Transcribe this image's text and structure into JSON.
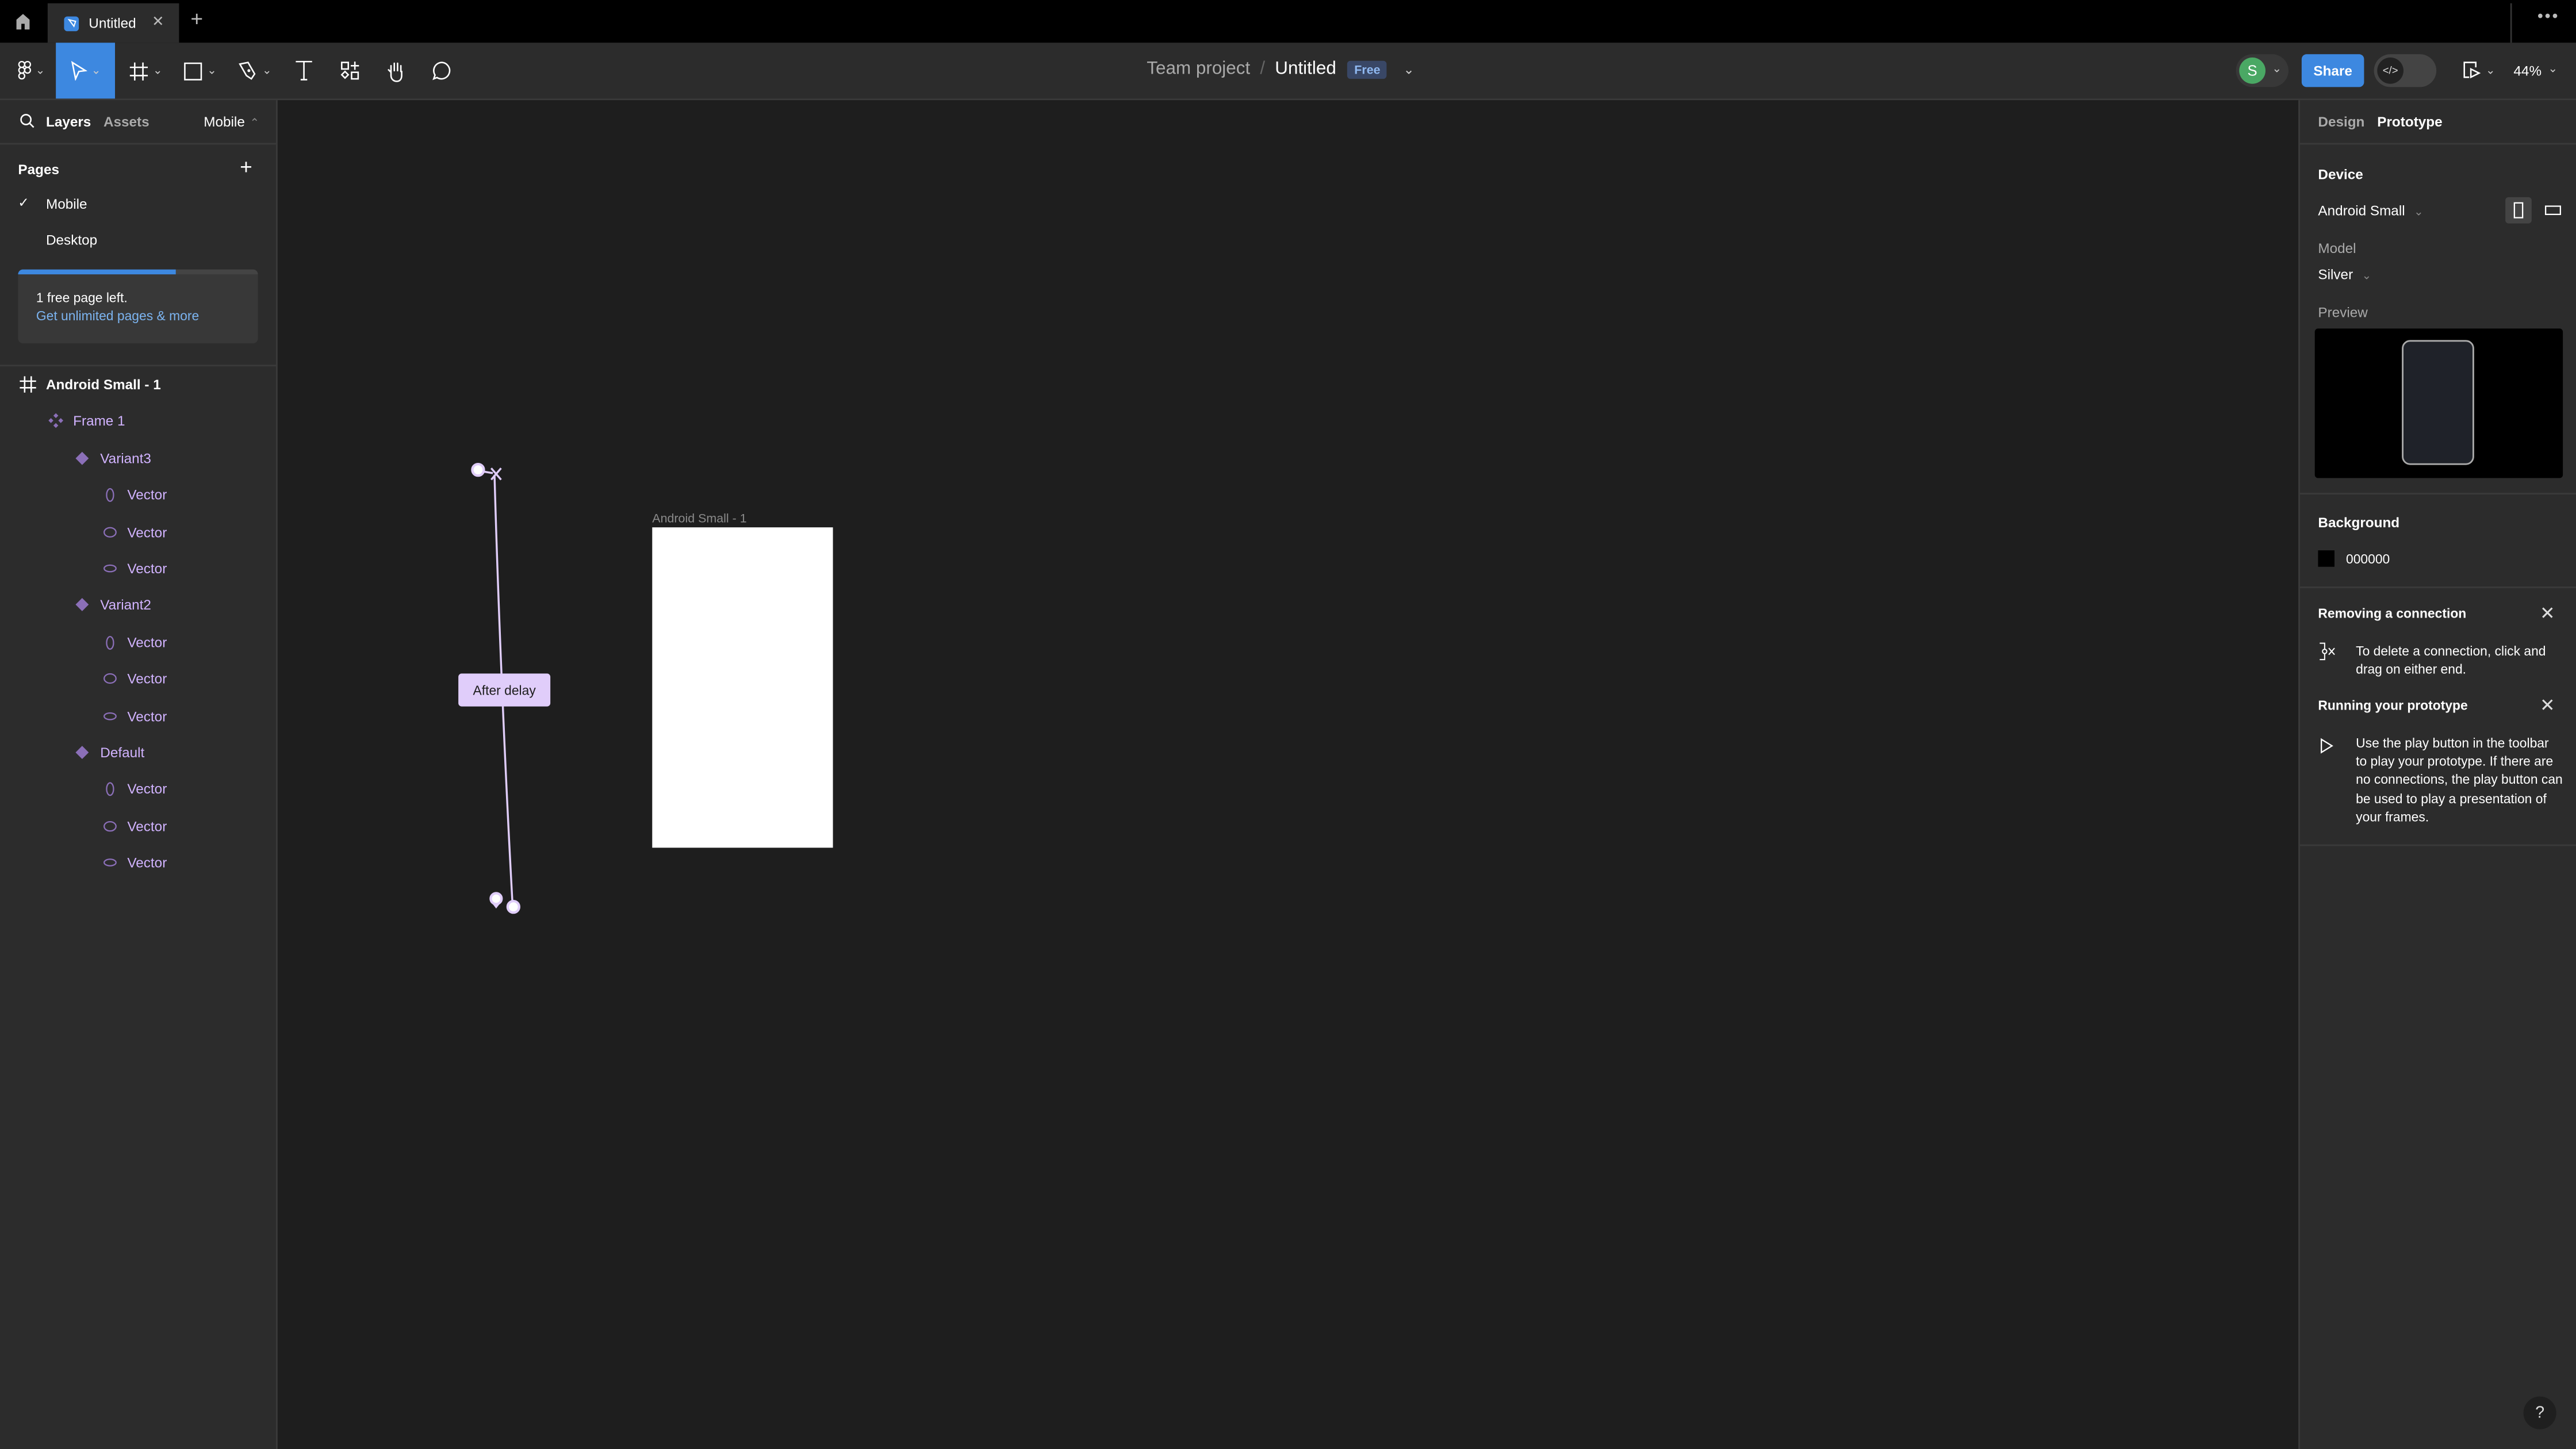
{
  "titlebar": {
    "tab_title": "Untitled",
    "tab_close": "✕",
    "new_tab": "+",
    "more": "•••"
  },
  "toolbar": {
    "tools": [
      "main-menu",
      "move",
      "frame",
      "shape",
      "pen",
      "text",
      "resources",
      "hand",
      "comment"
    ],
    "active_tool": "move",
    "chevron": "⌄"
  },
  "breadcrumb": {
    "team": "Team project",
    "separator": "/",
    "file": "Untitled",
    "plan_badge": "Free",
    "chevron": "⌄"
  },
  "header_right": {
    "avatar_initial": "S",
    "avatar_color": "#4aa864",
    "share_label": "Share",
    "devmode_label": "</>",
    "zoom_level": "44%",
    "chevron": "⌄"
  },
  "left_panel": {
    "tabs": {
      "layers": "Layers",
      "assets": "Assets"
    },
    "page_switcher": "Mobile",
    "page_switcher_chevron": "⌃",
    "pages_header": "Pages",
    "add_page": "+",
    "pages": [
      {
        "label": "Mobile",
        "selected": true,
        "check": "✓"
      },
      {
        "label": "Desktop",
        "selected": false,
        "check": ""
      }
    ],
    "upsell": {
      "progress": 0.66,
      "text": "1 free page left.",
      "link": "Get unlimited pages & more"
    },
    "layers": [
      {
        "label": "Android Small - 1",
        "type": "frame",
        "depth": 0
      },
      {
        "label": "Frame 1",
        "type": "component-set",
        "depth": 1
      },
      {
        "label": "Variant3",
        "type": "component",
        "depth": 2
      },
      {
        "label": "Vector",
        "type": "vector-tall",
        "depth": 3
      },
      {
        "label": "Vector",
        "type": "vector-oval",
        "depth": 3
      },
      {
        "label": "Vector",
        "type": "vector-flat",
        "depth": 3
      },
      {
        "label": "Variant2",
        "type": "component",
        "depth": 2
      },
      {
        "label": "Vector",
        "type": "vector-tall",
        "depth": 3
      },
      {
        "label": "Vector",
        "type": "vector-oval",
        "depth": 3
      },
      {
        "label": "Vector",
        "type": "vector-flat",
        "depth": 3
      },
      {
        "label": "Default",
        "type": "component",
        "depth": 2
      },
      {
        "label": "Vector",
        "type": "vector-tall",
        "depth": 3
      },
      {
        "label": "Vector",
        "type": "vector-oval",
        "depth": 3
      },
      {
        "label": "Vector",
        "type": "vector-flat",
        "depth": 3
      }
    ]
  },
  "canvas": {
    "frame_label": "Android Small - 1",
    "connection_trigger": "After delay",
    "connection_color": "#e0cdfa"
  },
  "right_panel": {
    "tabs": {
      "design": "Design",
      "prototype": "Prototype"
    },
    "active_tab": "Prototype",
    "device_heading": "Device",
    "device_value": "Android Small",
    "model_label": "Model",
    "model_value": "Silver",
    "preview_label": "Preview",
    "background_heading": "Background",
    "background_hex": "000000",
    "chevron": "⌄",
    "tips": [
      {
        "title": "Removing a connection",
        "text": "To delete a connection, click and drag on either end.",
        "close": "✕"
      },
      {
        "title": "Running your prototype",
        "text": "Use the play button in the toolbar to play your prototype. If there are no connections, the play button can be used to play a presentation of your frames.",
        "close": "✕"
      }
    ]
  },
  "help": "?"
}
